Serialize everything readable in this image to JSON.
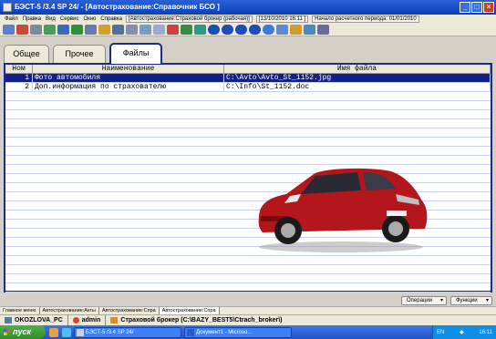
{
  "window": {
    "title": "БЭСТ-5 /3.4 SP 24/ - [Автострахование:Справочник БСО ]",
    "buttons": [
      "_",
      "□",
      "×"
    ]
  },
  "menubar": {
    "items": [
      "Файл",
      "Правка",
      "Вид",
      "Сервис",
      "Окно",
      "Справка"
    ],
    "context": "[Автострахование:Страховой брокер (рабочая)]",
    "date": "[13/10/2010 16:11 ]",
    "period": "Начало расчетного периода: 01/01/2010"
  },
  "toolbar": {
    "icons": [
      "print-icon",
      "printer-icon",
      "copy-icon",
      "edit-icon",
      "calc-icon",
      "new-icon",
      "paste-icon",
      "open-icon",
      "tool-icon",
      "help-icon",
      "filter-icon",
      "filter-cancel-icon",
      "scissors-icon",
      "tree-icon",
      "refresh-icon",
      "first-icon",
      "prev-icon",
      "next-icon",
      "last-icon",
      "question-icon",
      "window-icon",
      "export-icon",
      "chart-icon",
      "settings-icon"
    ]
  },
  "tabs": [
    {
      "label": "Общее",
      "active": false
    },
    {
      "label": "Прочее",
      "active": false
    },
    {
      "label": "Файлы",
      "active": true
    }
  ],
  "table": {
    "headers": [
      "Ном",
      "Наименование",
      "Имя файла"
    ],
    "rows": [
      {
        "num": "1",
        "name": "Фото автомобиля",
        "file": "C:\\Avto\\Avto_St_1152.jpg",
        "selected": true
      },
      {
        "num": "2",
        "name": "Доп.информация по страхователю",
        "file": "C:\\Info\\St_1152.doc",
        "selected": false
      }
    ]
  },
  "bottom": {
    "operations": "Операции",
    "functions": "Функции"
  },
  "doc_tabs": [
    "Главное меню",
    "Автострахование:Акты",
    "Автострахование:Спра",
    "Автострахование:Спра"
  ],
  "status": {
    "computer": "OKOZLOVA_PC",
    "user": "admin",
    "db": "Страховой брокер (C:\\BAZY_BEST5\\Ctrach_broker\\)"
  },
  "taskbar": {
    "start": "пуск",
    "tasks": [
      "БЭСТ-5 /3.4 SP 24/",
      "Документ1 - Microso..."
    ],
    "lang": "EN",
    "time": "16:11"
  },
  "colors": {
    "selection": "#10208c",
    "titlebar": "#0a3fb8",
    "car": "#b3171b"
  }
}
